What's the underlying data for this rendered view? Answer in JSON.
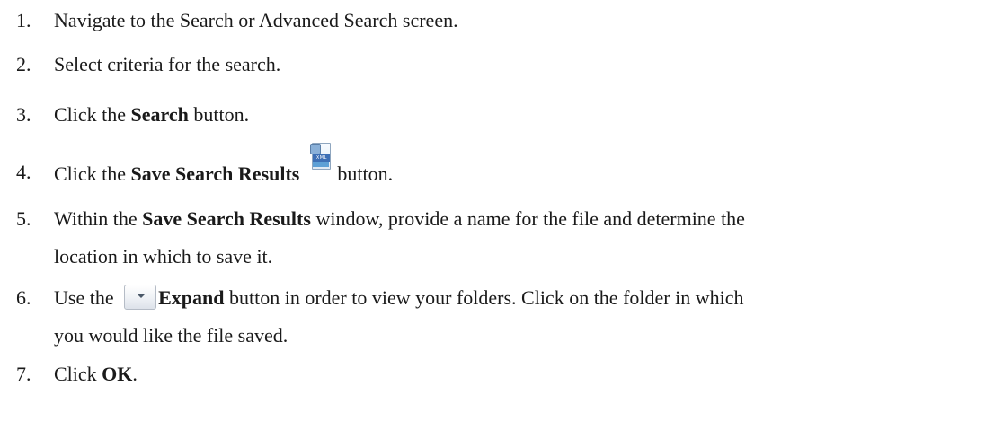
{
  "steps": [
    {
      "num": "1.",
      "text": "Navigate to the Search or Advanced Search screen."
    },
    {
      "num": "2.",
      "text": "Select criteria for the search."
    },
    {
      "num": "3.",
      "pre": "Click the ",
      "bold": "Search",
      "post": " button."
    },
    {
      "num": "4.",
      "pre": "Click the ",
      "bold": "Save Search Results",
      "post": "button.",
      "icon": "xml-save-icon",
      "icon_label": "XML"
    },
    {
      "num": "5.",
      "pre": "Within the ",
      "bold": "Save Search Results",
      "post": " window, provide a name for the file and determine the",
      "line2": "location in which to save it."
    },
    {
      "num": "6.",
      "pre": "Use the ",
      "bold": "Expand",
      "post": " button in order to view your folders. Click on the folder in which",
      "line2": "you would like the file saved.",
      "icon": "chevron-down-icon"
    },
    {
      "num": "7.",
      "pre": "Click ",
      "bold": "OK",
      "post": "."
    }
  ]
}
